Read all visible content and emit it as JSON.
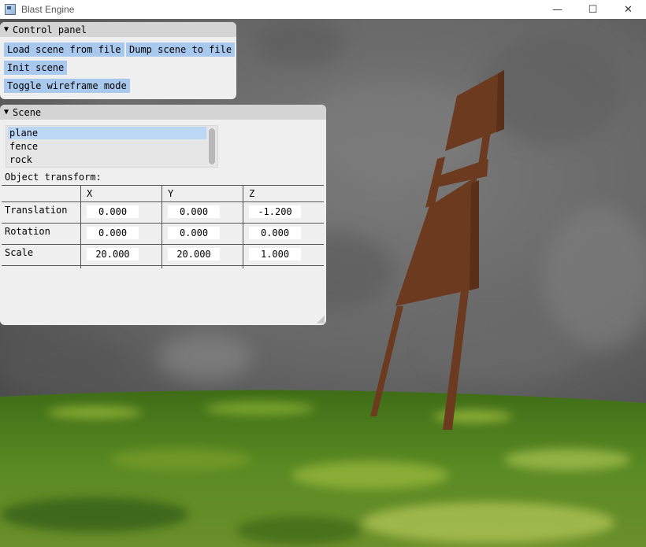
{
  "window": {
    "title": "Blast Engine",
    "controls": [
      "—",
      "☐",
      "✕"
    ]
  },
  "control_panel": {
    "title": "Control panel",
    "buttons": {
      "load": "Load scene from file",
      "dump": "Dump scene to file",
      "init": "Init scene",
      "wireframe": "Toggle wireframe mode"
    }
  },
  "scene_panel": {
    "title": "Scene",
    "objects": [
      "plane",
      "fence",
      "rock"
    ],
    "selected_object": "plane",
    "transform_label": "Object transform:",
    "columns": [
      "X",
      "Y",
      "Z"
    ],
    "rows": [
      {
        "label": "Translation",
        "values": [
          "0.000",
          "0.000",
          "-1.200"
        ]
      },
      {
        "label": "Rotation",
        "values": [
          "0.000",
          "0.000",
          "0.000"
        ]
      },
      {
        "label": "Scale",
        "values": [
          "20.000",
          "20.000",
          "1.000"
        ]
      }
    ]
  },
  "colors": {
    "rock_background": "#6e6e6e",
    "grass_ground": "#4e7a1c",
    "fence": "#6b3a1f",
    "button_blue": "#a9c8ee",
    "panel_bg": "#efefef"
  }
}
